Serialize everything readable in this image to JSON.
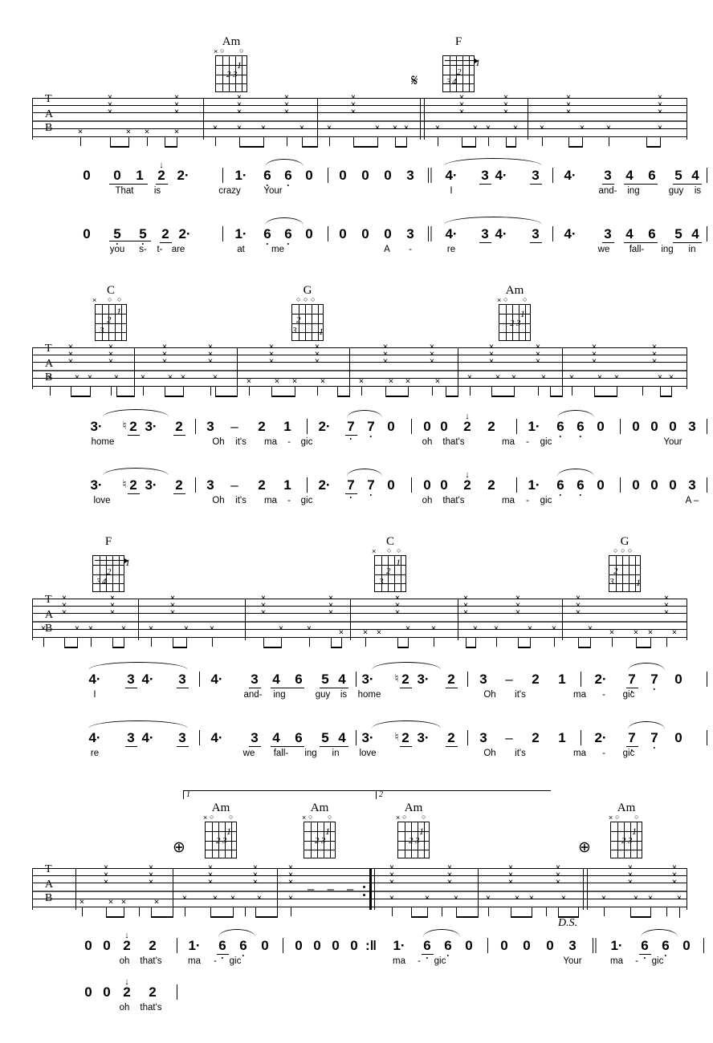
{
  "document": {
    "type": "guitar-tablature-score",
    "staff_labels": [
      "T",
      "A",
      "B"
    ],
    "strum_symbol": "x",
    "symbols": {
      "segno": "𝄋",
      "coda": "⊕",
      "ds": "D.S.",
      "ending_1": "1",
      "ending_2": "2"
    }
  },
  "systems": [
    {
      "id": "system-1",
      "chords": [
        {
          "name": "Am",
          "markers": "xo  o",
          "fingers": [
            "1",
            "2",
            "3"
          ]
        },
        {
          "name": "F",
          "markers": "",
          "fingers": [
            "1",
            "2",
            "34"
          ],
          "barre": true
        }
      ],
      "voice_a": {
        "notes": "0  0 1 2 2·  | 1·  6 6 0 | 0 0 0 3 ‖ 4·  3 4·  3 | 4·   3 4 6  5 4",
        "groups": [
          {
            "n": "0"
          },
          {
            "n": "0"
          },
          {
            "n": "1"
          },
          {
            "n": "2"
          },
          {
            "n": "2·"
          },
          {
            "n": "1·"
          },
          {
            "n": "6"
          },
          {
            "n": "6"
          },
          {
            "n": "0"
          },
          {
            "n": "0"
          },
          {
            "n": "0"
          },
          {
            "n": "0"
          },
          {
            "n": "3"
          },
          {
            "n": "4·"
          },
          {
            "n": "3"
          },
          {
            "n": "4·"
          },
          {
            "n": "3"
          },
          {
            "n": "4·"
          },
          {
            "n": "3"
          },
          {
            "n": "4"
          },
          {
            "n": "6"
          },
          {
            "n": "5"
          },
          {
            "n": "4"
          }
        ],
        "lyrics": [
          "That",
          "is",
          "crazy",
          "Your",
          "I",
          "and-",
          "ing",
          "guy",
          "is"
        ]
      },
      "voice_b": {
        "groups": [
          {
            "n": "0"
          },
          {
            "n": "5"
          },
          {
            "n": "5"
          },
          {
            "n": "2"
          },
          {
            "n": "2·"
          },
          {
            "n": "1·"
          },
          {
            "n": "6"
          },
          {
            "n": "6"
          },
          {
            "n": "0"
          },
          {
            "n": "0"
          },
          {
            "n": "0"
          },
          {
            "n": "0"
          },
          {
            "n": "3"
          },
          {
            "n": "4·"
          },
          {
            "n": "3"
          },
          {
            "n": "4·"
          },
          {
            "n": "3"
          },
          {
            "n": "4·"
          },
          {
            "n": "3"
          },
          {
            "n": "4"
          },
          {
            "n": "6"
          },
          {
            "n": "5"
          },
          {
            "n": "4"
          }
        ],
        "lyrics": [
          "you",
          "s-",
          "t-",
          "are",
          "at",
          "me",
          "A",
          "-",
          "re",
          "we",
          "fall-",
          "ing",
          "in"
        ]
      }
    },
    {
      "id": "system-2",
      "chords": [
        {
          "name": "C",
          "markers": "x  o o",
          "fingers": [
            "1",
            "2",
            "3"
          ]
        },
        {
          "name": "G",
          "markers": "o o o",
          "fingers": [
            "1",
            "2",
            "3"
          ]
        },
        {
          "name": "Am",
          "markers": "xo  o",
          "fingers": [
            "1",
            "2",
            "3"
          ]
        }
      ],
      "voice_a": {
        "groups": [
          {
            "n": "3·"
          },
          {
            "n": "2",
            "acc": "♮"
          },
          {
            "n": "3·"
          },
          {
            "n": "2"
          },
          {
            "n": "3"
          },
          {
            "n": "–"
          },
          {
            "n": "2"
          },
          {
            "n": "1"
          },
          {
            "n": "2·"
          },
          {
            "n": "7"
          },
          {
            "n": "7"
          },
          {
            "n": "0"
          },
          {
            "n": "0"
          },
          {
            "n": "0"
          },
          {
            "n": "2"
          },
          {
            "n": "2"
          },
          {
            "n": "1·"
          },
          {
            "n": "6"
          },
          {
            "n": "6"
          },
          {
            "n": "0"
          },
          {
            "n": "0"
          },
          {
            "n": "0"
          },
          {
            "n": "0"
          },
          {
            "n": "3"
          }
        ],
        "lyrics": [
          "home",
          "Oh",
          "it's",
          "ma",
          "-",
          "gic",
          "oh",
          "that's",
          "ma",
          "-",
          "gic",
          "Your"
        ]
      },
      "voice_b": {
        "groups": [
          {
            "n": "3·"
          },
          {
            "n": "2",
            "acc": "♮"
          },
          {
            "n": "3·"
          },
          {
            "n": "2"
          },
          {
            "n": "3"
          },
          {
            "n": "–"
          },
          {
            "n": "2"
          },
          {
            "n": "1"
          },
          {
            "n": "2·"
          },
          {
            "n": "7"
          },
          {
            "n": "7"
          },
          {
            "n": "0"
          },
          {
            "n": "0"
          },
          {
            "n": "0"
          },
          {
            "n": "2"
          },
          {
            "n": "2"
          },
          {
            "n": "1·"
          },
          {
            "n": "6"
          },
          {
            "n": "6"
          },
          {
            "n": "0"
          },
          {
            "n": "0"
          },
          {
            "n": "0"
          },
          {
            "n": "0"
          },
          {
            "n": "3"
          }
        ],
        "lyrics": [
          "love",
          "Oh",
          "it's",
          "ma",
          "-",
          "gic",
          "oh",
          "that's",
          "ma",
          "-",
          "gic",
          "A –"
        ]
      }
    },
    {
      "id": "system-3",
      "chords": [
        {
          "name": "F",
          "markers": "",
          "fingers": [
            "1",
            "2",
            "34"
          ],
          "barre": true
        },
        {
          "name": "C",
          "markers": "x  o o",
          "fingers": [
            "1",
            "2",
            "3"
          ]
        },
        {
          "name": "G",
          "markers": "o o o",
          "fingers": [
            "1",
            "2",
            "3"
          ]
        }
      ],
      "voice_a": {
        "groups": [
          {
            "n": "4·"
          },
          {
            "n": "3"
          },
          {
            "n": "4·"
          },
          {
            "n": "3"
          },
          {
            "n": "4·"
          },
          {
            "n": "3"
          },
          {
            "n": "4"
          },
          {
            "n": "6"
          },
          {
            "n": "5"
          },
          {
            "n": "4"
          },
          {
            "n": "3·"
          },
          {
            "n": "2",
            "acc": "♮"
          },
          {
            "n": "3·"
          },
          {
            "n": "2"
          },
          {
            "n": "3"
          },
          {
            "n": "–"
          },
          {
            "n": "2"
          },
          {
            "n": "1"
          },
          {
            "n": "2·"
          },
          {
            "n": "7"
          },
          {
            "n": "7"
          },
          {
            "n": "0"
          }
        ],
        "lyrics": [
          "I",
          "and-",
          "ing",
          "guy",
          "is",
          "home",
          "Oh",
          "it's",
          "ma",
          "-",
          "gic"
        ]
      },
      "voice_b": {
        "groups": [
          {
            "n": "4·"
          },
          {
            "n": "3"
          },
          {
            "n": "4·"
          },
          {
            "n": "3"
          },
          {
            "n": "4·"
          },
          {
            "n": "3"
          },
          {
            "n": "4"
          },
          {
            "n": "6"
          },
          {
            "n": "5"
          },
          {
            "n": "4"
          },
          {
            "n": "3·"
          },
          {
            "n": "2",
            "acc": "♮"
          },
          {
            "n": "3·"
          },
          {
            "n": "2"
          },
          {
            "n": "3"
          },
          {
            "n": "–"
          },
          {
            "n": "2"
          },
          {
            "n": "1"
          },
          {
            "n": "2·"
          },
          {
            "n": "7"
          },
          {
            "n": "7"
          },
          {
            "n": "0"
          }
        ],
        "lyrics": [
          "re",
          "we",
          "fall-",
          "ing",
          "in",
          "love",
          "Oh",
          "it's",
          "ma",
          "-",
          "gic"
        ]
      }
    },
    {
      "id": "system-4",
      "chords": [
        {
          "name": "Am",
          "markers": "xo  o",
          "fingers": [
            "1",
            "2",
            "3"
          ]
        },
        {
          "name": "Am",
          "markers": "xo  o",
          "fingers": [
            "1",
            "2",
            "3"
          ]
        },
        {
          "name": "Am",
          "markers": "xo  o",
          "fingers": [
            "1",
            "2",
            "3"
          ]
        },
        {
          "name": "Am",
          "markers": "xo  o",
          "fingers": [
            "1",
            "2",
            "3"
          ]
        }
      ],
      "voice_a": {
        "groups": [
          {
            "n": "0"
          },
          {
            "n": "0"
          },
          {
            "n": "2"
          },
          {
            "n": "2"
          },
          {
            "n": "1·"
          },
          {
            "n": "6"
          },
          {
            "n": "6"
          },
          {
            "n": "0"
          },
          {
            "n": "0"
          },
          {
            "n": "0"
          },
          {
            "n": "0"
          },
          {
            "n": "0"
          },
          {
            "n": "1·"
          },
          {
            "n": "6"
          },
          {
            "n": "6"
          },
          {
            "n": "0"
          },
          {
            "n": "0"
          },
          {
            "n": "0"
          },
          {
            "n": "0"
          },
          {
            "n": "3"
          },
          {
            "n": "1·"
          },
          {
            "n": "6"
          },
          {
            "n": "6"
          },
          {
            "n": "0"
          }
        ],
        "lyrics": [
          "oh",
          "that's",
          "ma",
          "-",
          "gic",
          "ma",
          "-",
          "gic",
          "Your",
          "ma",
          "-",
          "gic"
        ]
      },
      "voice_b": {
        "groups": [
          {
            "n": "0"
          },
          {
            "n": "0"
          },
          {
            "n": "2"
          },
          {
            "n": "2"
          }
        ],
        "lyrics": [
          "oh",
          "that's"
        ]
      }
    }
  ]
}
